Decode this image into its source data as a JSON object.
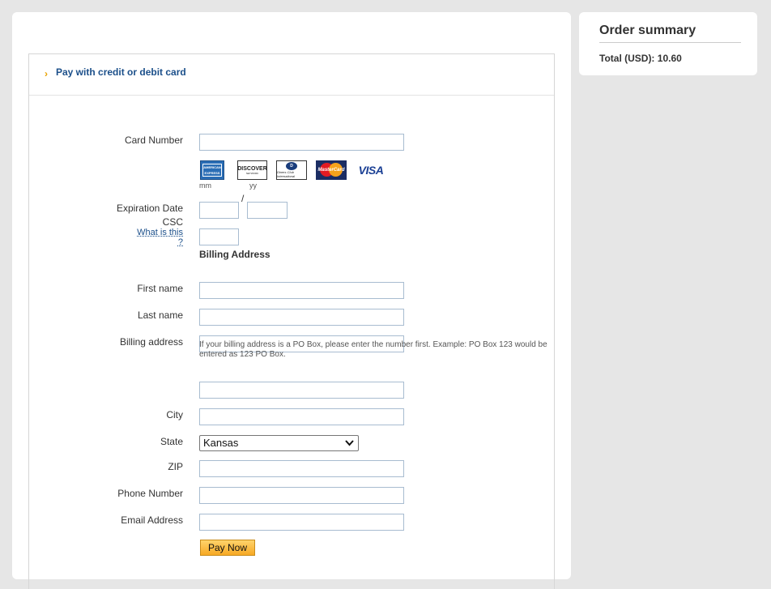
{
  "summary": {
    "title": "Order summary",
    "total": "Total (USD): 10.60"
  },
  "header": {
    "chevron": "›",
    "title": "Pay with credit or debit card"
  },
  "card_logos": {
    "amex": "AMERICAN EXPRESS",
    "discover": "DISCOVER",
    "discover_sub": "NETWORK",
    "diners": "D",
    "diners_sub": "Diners Club International",
    "mastercard": "MasterCard",
    "visa": "VISA"
  },
  "form": {
    "card_number_label": "Card Number",
    "expiration_label": "Expiration Date",
    "mm_hint": "mm",
    "yy_hint": "yy",
    "slash": "/",
    "csc_label": "CSC",
    "csc_link": "What is this ?",
    "billing_heading": "Billing Address",
    "first_name_label": "First name",
    "last_name_label": "Last name",
    "billing_address_label": "Billing address",
    "billing_help": "If your billing address is a PO Box, please enter the number first. Example: PO Box 123 would be entered as 123 PO Box.",
    "city_label": "City",
    "state_label": "State",
    "state_value": "Kansas",
    "zip_label": "ZIP",
    "phone_label": "Phone Number",
    "email_label": "Email Address",
    "pay_button": "Pay Now"
  },
  "colors": {
    "page_bg": "#e6e6e6",
    "link": "#1b4f8a",
    "accent": "#e8a200",
    "input_border": "#a8bcd0"
  }
}
